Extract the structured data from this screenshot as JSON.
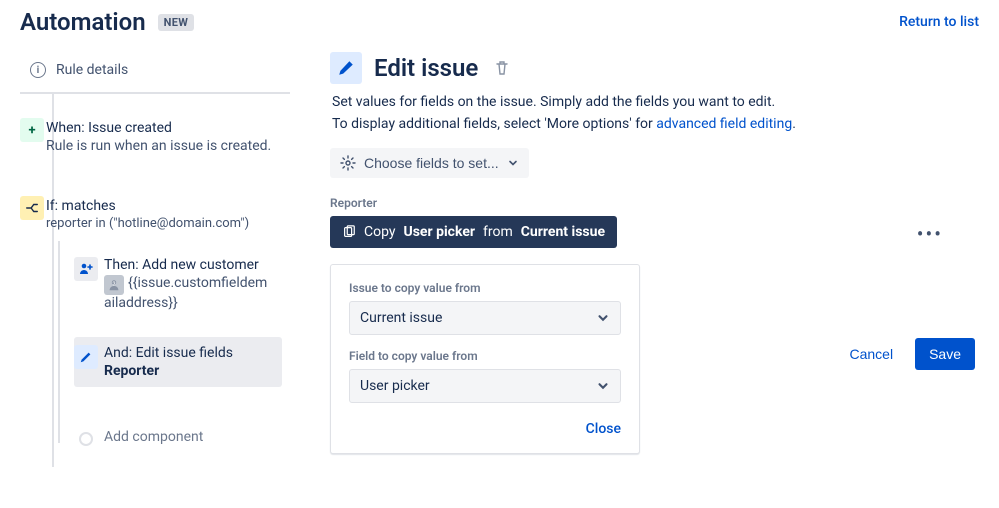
{
  "header": {
    "title": "Automation",
    "badge": "NEW",
    "return_link": "Return to list"
  },
  "sidebar": {
    "rule_details": "Rule details",
    "when": {
      "title": "When: Issue created",
      "sub": "Rule is run when an issue is created."
    },
    "if": {
      "title": "If: matches",
      "sub": "reporter in (\"hotline@domain.com\")"
    },
    "then": {
      "title": "Then: Add new customer",
      "sub": "{{issue.customfieldemailaddress}}"
    },
    "and": {
      "title": "And: Edit issue fields",
      "sub": "Reporter"
    },
    "add_component": "Add component"
  },
  "main": {
    "title": "Edit issue",
    "desc1": "Set values for fields on the issue. Simply add the fields you want to edit.",
    "desc2_pre": "To display additional fields, select 'More options' for ",
    "desc2_link": "advanced field editing",
    "choose_fields": "Choose fields to set...",
    "reporter_label": "Reporter",
    "copy_chip": {
      "prefix": "Copy",
      "field": "User picker",
      "mid": "from",
      "source": "Current issue"
    },
    "popup": {
      "issue_label": "Issue to copy value from",
      "issue_value": "Current issue",
      "field_label": "Field to copy value from",
      "field_value": "User picker",
      "close": "Close"
    },
    "cancel": "Cancel",
    "save": "Save"
  }
}
